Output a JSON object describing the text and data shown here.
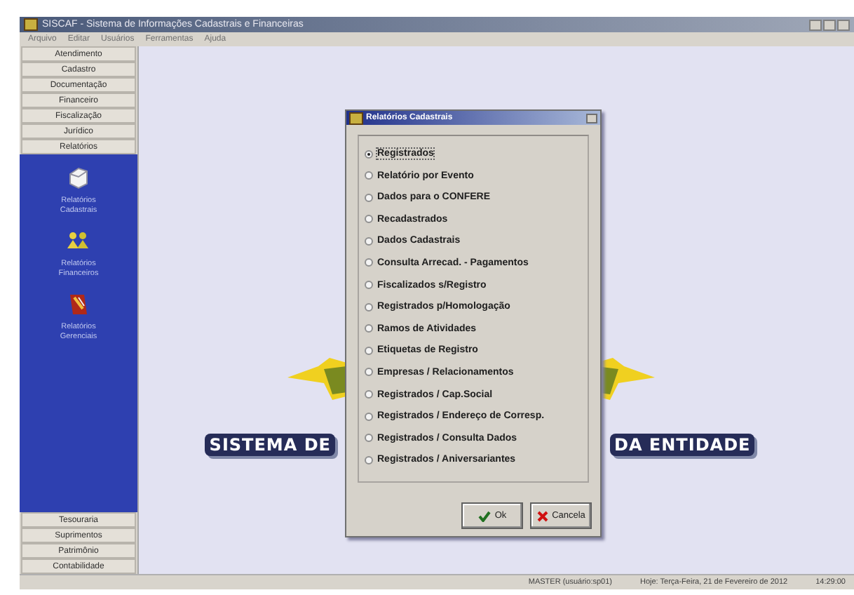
{
  "window": {
    "title": "SISCAF - Sistema de Informações Cadastrais e Financeiras"
  },
  "menu": [
    "Arquivo",
    "Editar",
    "Usuários",
    "Ferramentas",
    "Ajuda"
  ],
  "sidebar": {
    "top_items": [
      "Atendimento",
      "Cadastro",
      "Documentação",
      "Financeiro",
      "Fiscalização",
      "Jurídico",
      "Relatórios"
    ],
    "panel_items": [
      {
        "kind": "box",
        "label": "Relatórios Cadastrais"
      },
      {
        "kind": "people",
        "label": "Relatórios Financeiros"
      },
      {
        "kind": "book",
        "label": "Relatórios Gerenciais"
      }
    ],
    "bottom_items": [
      "Tesouraria",
      "Suprimentos",
      "Patrimônio",
      "Contabilidade"
    ]
  },
  "logo": {
    "left_text": "SISTEMA DE",
    "right_text": "DA ENTIDADE"
  },
  "dialog": {
    "title": "Relatórios Cadastrais",
    "options": [
      {
        "label": "Registrados",
        "selected": true
      },
      {
        "label": "Relatório por Evento",
        "selected": false
      },
      {
        "label": "Dados para o CONFERE",
        "selected": false
      },
      {
        "label": "Recadastrados",
        "selected": false
      },
      {
        "label": "Dados Cadastrais",
        "selected": false
      },
      {
        "label": "Consulta Arrecad. - Pagamentos",
        "selected": false
      },
      {
        "label": "Fiscalizados s/Registro",
        "selected": false
      },
      {
        "label": "Registrados p/Homologação",
        "selected": false
      },
      {
        "label": "Ramos de Atividades",
        "selected": false
      },
      {
        "label": "Etiquetas de Registro",
        "selected": false
      },
      {
        "label": "Empresas / Relacionamentos",
        "selected": false
      },
      {
        "label": "Registrados / Cap.Social",
        "selected": false
      },
      {
        "label": "Registrados / Endereço de Corresp.",
        "selected": false
      },
      {
        "label": "Registrados / Consulta Dados",
        "selected": false
      },
      {
        "label": "Registrados / Aniversariantes",
        "selected": false
      }
    ],
    "buttons": [
      {
        "kind": "ok",
        "label": "Ok"
      },
      {
        "kind": "cancel",
        "label": "Cancela"
      }
    ]
  },
  "status_bar": [
    "MASTER (usuário:sp01)",
    "Hoje: Terça-Feira, 21 de Fevereiro de 2012",
    "14:29:00"
  ]
}
